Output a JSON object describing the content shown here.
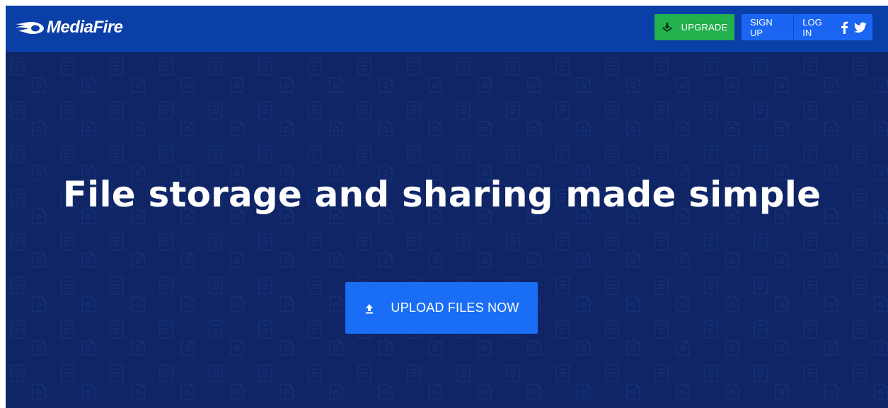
{
  "brand": {
    "name": "MediaFire",
    "colors": {
      "header_bg": "#0a3fa8",
      "hero_bg": "#0f2566",
      "upgrade_bg": "#23b14d",
      "button_blue": "#1a6ef5",
      "text": "#ffffff"
    }
  },
  "header": {
    "upgrade_label": "UPGRADE",
    "upgrade_icon": "download-tray-icon",
    "signup_label": "SIGN UP",
    "login_label": "LOG IN",
    "social": {
      "facebook_glyph": "f",
      "twitter_icon": "twitter-bird-icon"
    }
  },
  "hero": {
    "headline": "File storage and sharing made simple",
    "upload_label": "UPLOAD FILES NOW",
    "upload_icon": "upload-arrow-icon"
  }
}
